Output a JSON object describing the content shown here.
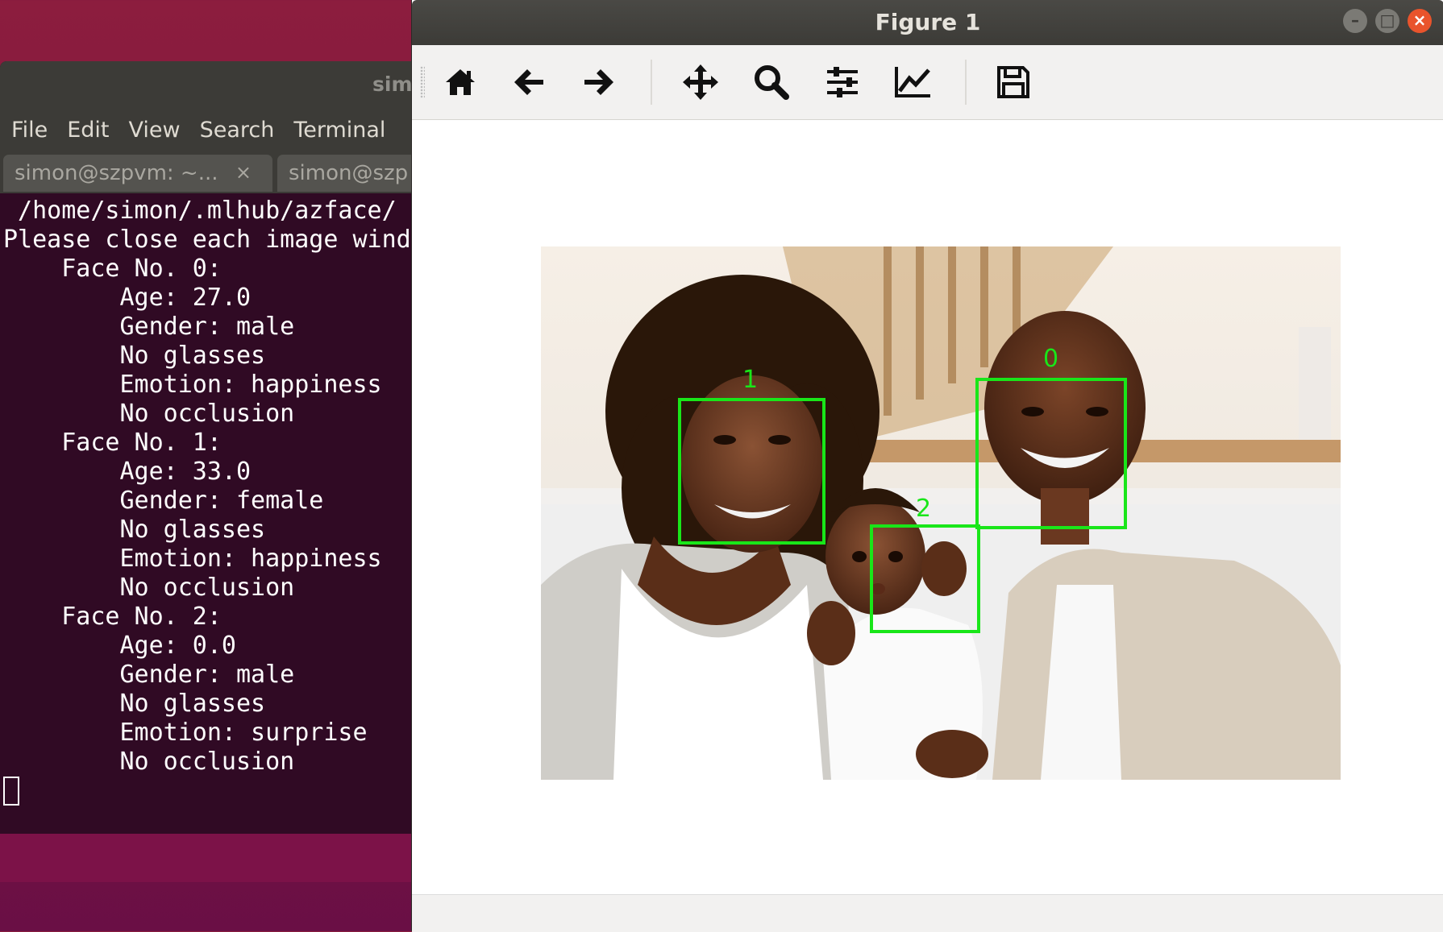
{
  "terminal": {
    "title_fragment": "sim",
    "menu": [
      "File",
      "Edit",
      "View",
      "Search",
      "Terminal"
    ],
    "tabs": [
      {
        "label": "simon@szpvm: ~...",
        "close": "×"
      },
      {
        "label": "simon@szp"
      }
    ],
    "lines": [
      " /home/simon/.mlhub/azface/",
      "Please close each image wind",
      "",
      "    Face No. 0:",
      "        Age: 27.0",
      "        Gender: male",
      "        No glasses",
      "        Emotion: happiness",
      "        No occlusion",
      "    Face No. 1:",
      "        Age: 33.0",
      "        Gender: female",
      "        No glasses",
      "        Emotion: happiness",
      "        No occlusion",
      "    Face No. 2:",
      "        Age: 0.0",
      "        Gender: male",
      "        No glasses",
      "        Emotion: surprise",
      "        No occlusion"
    ]
  },
  "figure": {
    "title": "Figure 1",
    "toolbar": [
      "home-icon",
      "back-arrow-icon",
      "forward-arrow-icon",
      "pan-icon",
      "zoom-icon",
      "configure-subplots-icon",
      "edit-axes-icon",
      "save-icon"
    ],
    "faces": [
      {
        "label": "0",
        "age": "27.0",
        "gender": "male",
        "emotion": "happiness"
      },
      {
        "label": "1",
        "age": "33.0",
        "gender": "female",
        "emotion": "happiness"
      },
      {
        "label": "2",
        "age": "0.0",
        "gender": "male",
        "emotion": "surprise"
      }
    ],
    "box_color": "#19e619"
  }
}
